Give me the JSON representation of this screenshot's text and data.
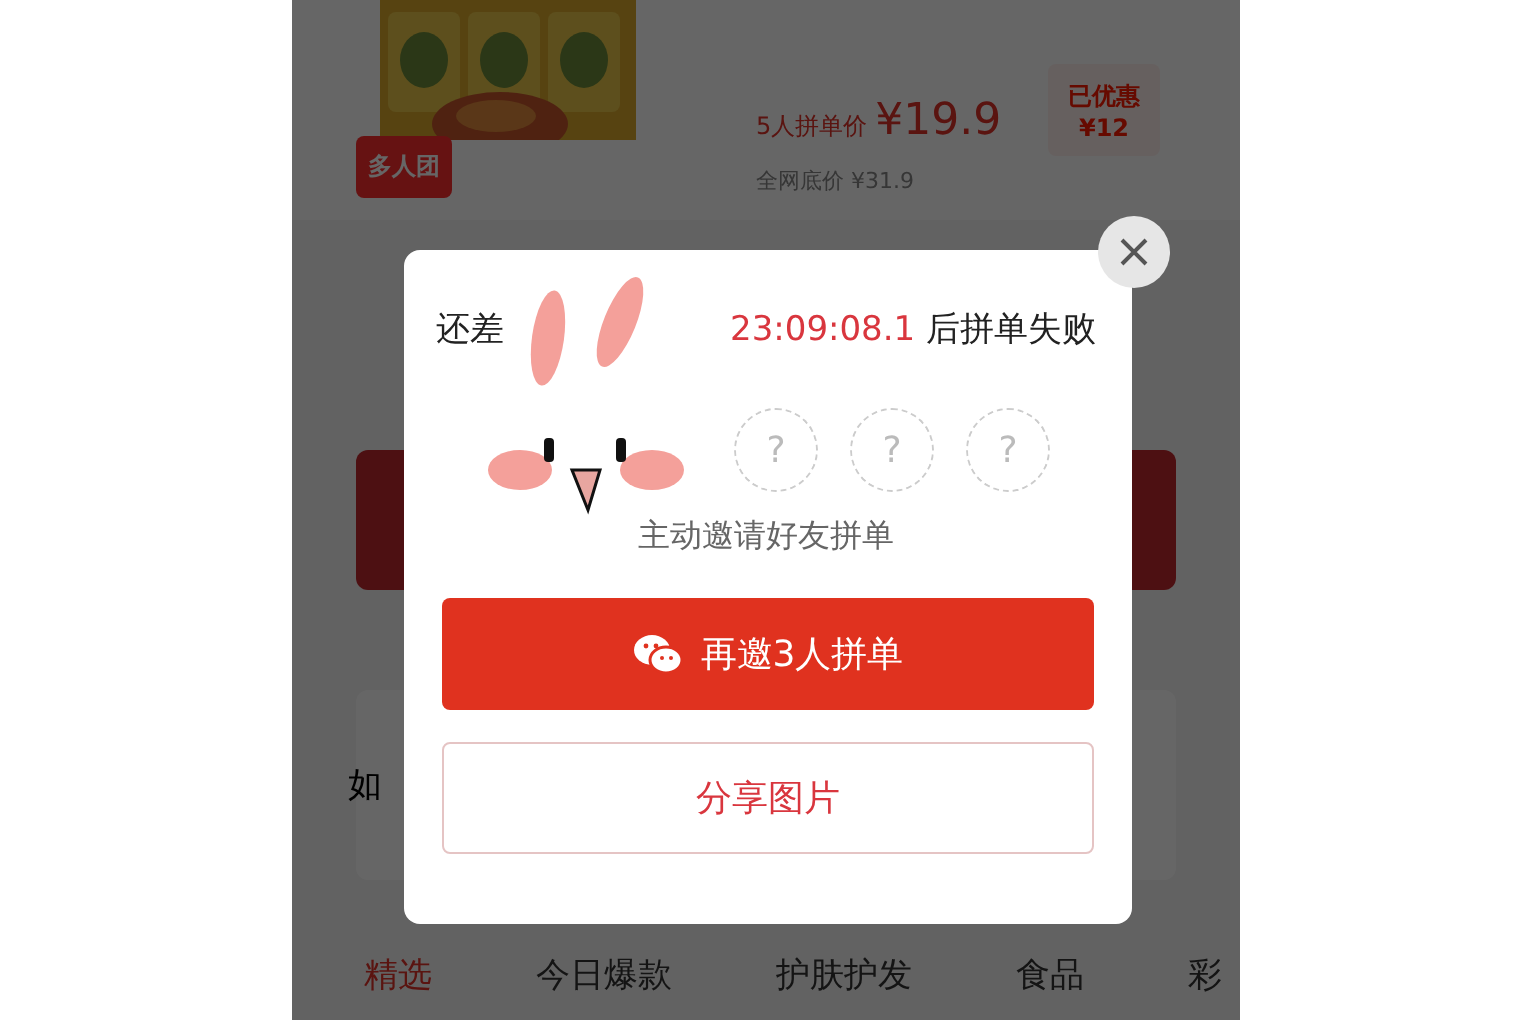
{
  "product": {
    "badge": "多人团",
    "price_label": "5人拼单价",
    "price": "¥19.9",
    "original_price": "全网底价 ¥31.9",
    "discount": {
      "label": "已优惠",
      "amount": "¥12"
    }
  },
  "card": {
    "text": "如"
  },
  "tabs": [
    {
      "label": "精选",
      "selected": true
    },
    {
      "label": "今日爆款",
      "selected": false
    },
    {
      "label": "护肤护发",
      "selected": false
    },
    {
      "label": "食品",
      "selected": false
    },
    {
      "label": "彩",
      "selected": false
    }
  ],
  "modal": {
    "prefix": "还差",
    "countdown": "23:09:08.1",
    "suffix": "后拼单失败",
    "slots": [
      "?",
      "?",
      "?"
    ],
    "hint": "主动邀请好友拼单",
    "primary_button": "再邀3人拼单",
    "secondary_button": "分享图片"
  }
}
